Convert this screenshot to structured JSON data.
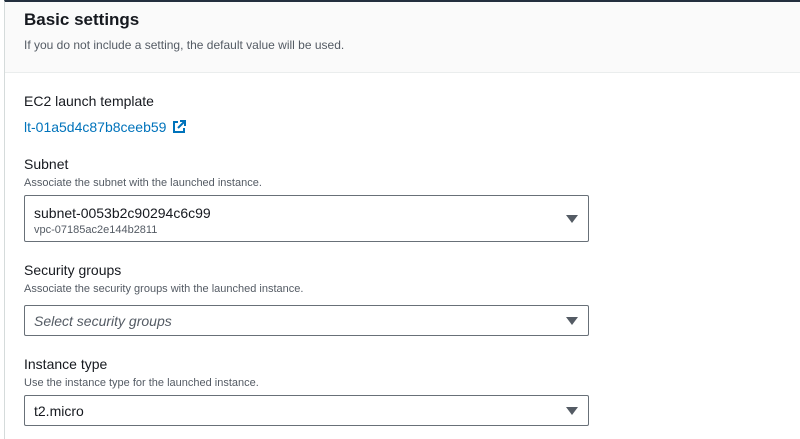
{
  "section": {
    "title": "Basic settings",
    "description": "If you do not include a setting, the default value will be used."
  },
  "launch_template": {
    "label": "EC2 launch template",
    "link_text": "lt-01a5d4c87b8ceeb59",
    "link_icon": "external-link-icon"
  },
  "subnet": {
    "label": "Subnet",
    "description": "Associate the subnet with the launched instance.",
    "selected_value": "subnet-0053b2c90294c6c99",
    "selected_detail": "vpc-07185ac2e144b2811"
  },
  "security_groups": {
    "label": "Security groups",
    "description": "Associate the security groups with the launched instance.",
    "placeholder": "Select security groups"
  },
  "instance_type": {
    "label": "Instance type",
    "description": "Use the instance type for the launched instance.",
    "selected_value": "t2.micro"
  },
  "colors": {
    "link": "#0073bb",
    "text": "#16191f",
    "muted": "#545b64",
    "border": "#687078"
  }
}
